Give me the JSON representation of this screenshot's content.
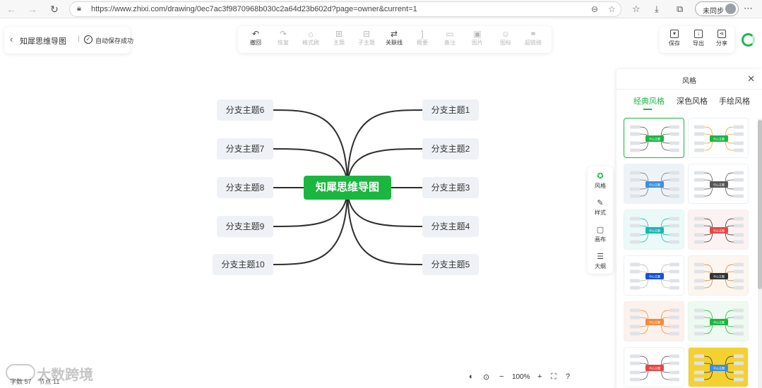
{
  "browser": {
    "url": "https://www.zhixi.com/drawing/0ec7ac3f9870968b030c2a64d23b602d?page=owner&current=1",
    "sync_label": "未同步"
  },
  "header": {
    "doc_title": "知犀思维导图",
    "save_status": "自动保存成功",
    "separator": "|"
  },
  "toolbar": {
    "items": [
      {
        "label": "撤回",
        "icon": "undo-icon",
        "glyph": "↶",
        "enabled": true
      },
      {
        "label": "恢复",
        "icon": "redo-icon",
        "glyph": "↷",
        "enabled": false
      },
      {
        "label": "格式刷",
        "icon": "format-brush-icon",
        "glyph": "⌂",
        "enabled": false
      },
      {
        "label": "主题",
        "icon": "topic-icon",
        "glyph": "⊞",
        "enabled": false
      },
      {
        "label": "子主题",
        "icon": "subtopic-icon",
        "glyph": "⊟",
        "enabled": false
      },
      {
        "label": "关联线",
        "icon": "relation-line-icon",
        "glyph": "⇄",
        "enabled": true
      },
      {
        "label": "概要",
        "icon": "summary-icon",
        "glyph": "]",
        "enabled": false
      },
      {
        "label": "备注",
        "icon": "note-icon",
        "glyph": "▭",
        "enabled": false
      },
      {
        "label": "图片",
        "icon": "image-icon",
        "glyph": "▣",
        "enabled": false
      },
      {
        "label": "图标",
        "icon": "emoji-icon",
        "glyph": "☺",
        "enabled": false
      },
      {
        "label": "超链接",
        "icon": "link-icon",
        "glyph": "⚭",
        "enabled": false
      }
    ]
  },
  "actions": {
    "save": "保存",
    "export": "导出",
    "share": "分享"
  },
  "mindmap": {
    "center": "知犀思维导图",
    "right": [
      "分支主题1",
      "分支主题2",
      "分支主题3",
      "分支主题4",
      "分支主题5"
    ],
    "left": [
      "分支主题6",
      "分支主题7",
      "分支主题8",
      "分支主题9",
      "分支主题10"
    ],
    "line_color": "#2d2d2d",
    "center_color": "#1bb640"
  },
  "side_tabs": [
    {
      "label": "风格",
      "icon": "palette-icon",
      "glyph": "✪",
      "active": true
    },
    {
      "label": "样式",
      "icon": "style-icon",
      "glyph": "✎",
      "active": false
    },
    {
      "label": "画布",
      "icon": "canvas-icon",
      "glyph": "▢",
      "active": false
    },
    {
      "label": "大纲",
      "icon": "outline-icon",
      "glyph": "☰",
      "active": false
    }
  ],
  "style_panel": {
    "title": "风格",
    "tabs": [
      "经典风格",
      "深色风格",
      "手绘风格"
    ],
    "active_tab": 0,
    "thumbnail_center_label": "中心主题",
    "thumbnails": [
      {
        "bg": "#ffffff",
        "center": "#1bb640",
        "line": "#555555"
      },
      {
        "bg": "#ffffff",
        "center": "#1bb640",
        "line": "#e8a23a"
      },
      {
        "bg": "#eef3f8",
        "center": "#3b8fe0",
        "line": "#777777"
      },
      {
        "bg": "#ffffff",
        "center": "#555555",
        "line": "#555555"
      },
      {
        "bg": "#eafaf8",
        "center": "#1ab5b0",
        "line": "#1ab5b0"
      },
      {
        "bg": "#fdf2f2",
        "center": "#e84545",
        "line": "#333333"
      },
      {
        "bg": "#ffffff",
        "center": "#1a4fd6",
        "line": "#bbbbbb"
      },
      {
        "bg": "#fdf6ef",
        "center": "#333333",
        "line": "#c0894a"
      },
      {
        "bg": "#fdf1ec",
        "center": "#f08a3c",
        "line": "#f08a3c"
      },
      {
        "bg": "#eefaf1",
        "center": "#1bb640",
        "line": "#1bb640"
      },
      {
        "bg": "#ffffff",
        "center": "#e84545",
        "line": "#555555"
      },
      {
        "bg": "#f5d130",
        "center": "#3b8fe0",
        "line": "#333333"
      }
    ]
  },
  "status": {
    "words": "字数 57",
    "topics": "节点 11",
    "zoom": "100%",
    "watermark": "大数跨境"
  }
}
